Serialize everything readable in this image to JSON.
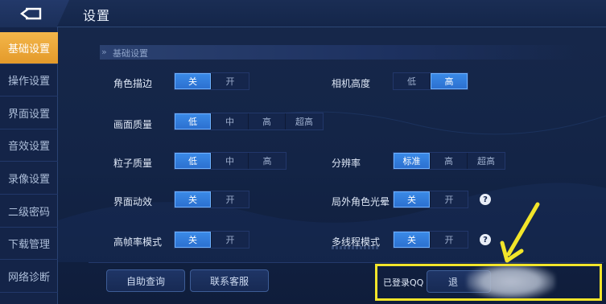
{
  "header": {
    "title": "设置",
    "back_icon": "back-arrow-icon"
  },
  "sidebar": {
    "items": [
      {
        "label": "基础设置",
        "active": true
      },
      {
        "label": "操作设置",
        "active": false
      },
      {
        "label": "界面设置",
        "active": false
      },
      {
        "label": "音效设置",
        "active": false
      },
      {
        "label": "录像设置",
        "active": false
      },
      {
        "label": "二级密码",
        "active": false
      },
      {
        "label": "下载管理",
        "active": false
      },
      {
        "label": "网络诊断",
        "active": false
      }
    ]
  },
  "section": {
    "title": "基础设置"
  },
  "settings": {
    "outline": {
      "label": "角色描边",
      "options": [
        "关",
        "开"
      ],
      "selected": 0
    },
    "quality": {
      "label": "画面质量",
      "options": [
        "低",
        "中",
        "高",
        "超高"
      ],
      "selected": 0
    },
    "particles": {
      "label": "粒子质量",
      "options": [
        "低",
        "中",
        "高"
      ],
      "selected": 0
    },
    "ui_anim": {
      "label": "界面动效",
      "options": [
        "关",
        "开"
      ],
      "selected": 0
    },
    "hfr": {
      "label": "高帧率模式",
      "options": [
        "关",
        "开"
      ],
      "selected": 0
    },
    "camera": {
      "label": "相机高度",
      "options": [
        "低",
        "高"
      ],
      "selected": 1
    },
    "resolution": {
      "label": "分辨率",
      "options": [
        "标准",
        "高",
        "超高"
      ],
      "selected": 0
    },
    "halo": {
      "label": "局外角色光晕",
      "options": [
        "关",
        "开"
      ],
      "selected": 0,
      "help": "?"
    },
    "multithread": {
      "label": "多线程模式",
      "options": [
        "关",
        "开"
      ],
      "selected": 0,
      "help": "?"
    }
  },
  "bottom": {
    "self_query": "自助查询",
    "contact": "联系客服",
    "qq_status": "已登录QQ",
    "logout_partial": "退"
  },
  "colors": {
    "accent_active_tab": "#e9a233",
    "selected_option": "#2f78d8",
    "annotation_box": "#f2e52a"
  }
}
